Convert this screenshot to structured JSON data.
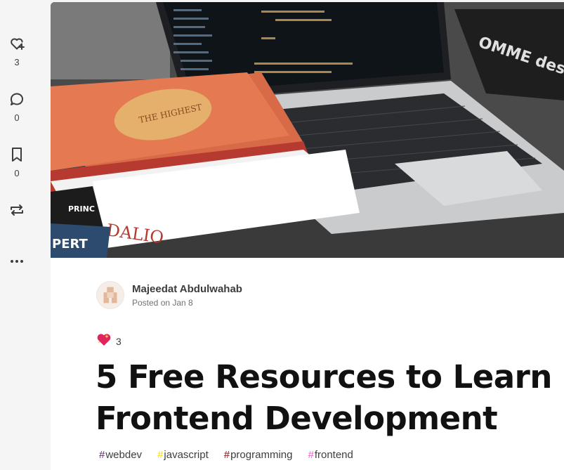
{
  "sidebar": {
    "items": [
      {
        "name": "like",
        "icon": "heart-plus-icon",
        "count": "3"
      },
      {
        "name": "comment",
        "icon": "comment-icon",
        "count": "0"
      },
      {
        "name": "save",
        "icon": "bookmark-icon",
        "count": "0"
      },
      {
        "name": "share",
        "icon": "repost-icon"
      },
      {
        "name": "more",
        "icon": "more-horizontal-icon"
      }
    ]
  },
  "cover": {
    "description_icon": "cover-image-icon",
    "book_spine_1": "DALIO",
    "book_spine_2": "PRINC",
    "book_spine_3": "PERT",
    "book_cover": "THE HIGHEST",
    "bag_text": "OMME des"
  },
  "author": {
    "name": "Majeedat Abdulwahab",
    "posted": "Posted on Jan 8"
  },
  "reactions": {
    "icon": "sparkle-heart-icon",
    "count": "3"
  },
  "article": {
    "title": "5 Free Resources to Learn Frontend Development"
  },
  "tags": [
    {
      "label": "webdev",
      "color": "#562765"
    },
    {
      "label": "javascript",
      "color": "#f7df1e"
    },
    {
      "label": "programming",
      "color": "#890606"
    },
    {
      "label": "frontend",
      "color": "#f459d4"
    }
  ]
}
